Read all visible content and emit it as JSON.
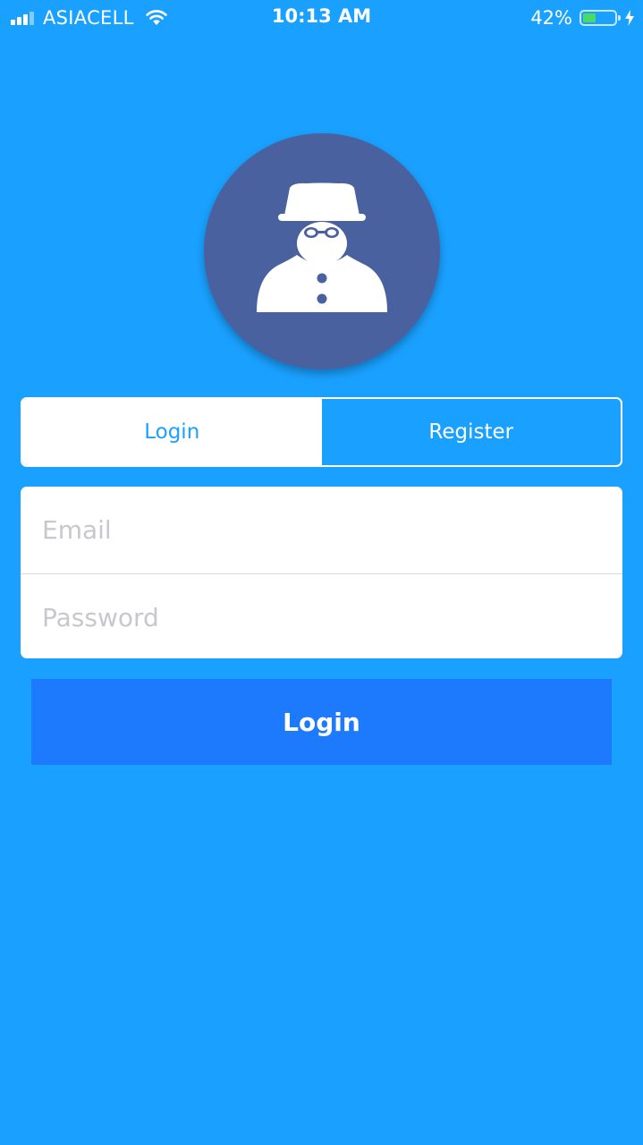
{
  "status_bar": {
    "carrier": "ASIACELL",
    "time": "10:13 AM",
    "battery_percent": "42%",
    "battery_level": 0.42,
    "battery_color": "#4cd964",
    "signal_icon": "cellular-signal-icon",
    "wifi_icon": "wifi-icon",
    "charging_icon": "charging-bolt-icon"
  },
  "avatar": {
    "icon": "incognito-spy-icon",
    "background": "#4a61a0"
  },
  "segment": {
    "tabs": [
      {
        "label": "Login",
        "selected": true
      },
      {
        "label": "Register",
        "selected": false
      }
    ]
  },
  "form": {
    "email": {
      "value": "",
      "placeholder": "Email"
    },
    "password": {
      "value": "",
      "placeholder": "Password"
    }
  },
  "login_button": {
    "label": "Login",
    "color": "#1d7afd"
  },
  "colors": {
    "background": "#1aa1ff",
    "accent": "#1aa1ff"
  }
}
